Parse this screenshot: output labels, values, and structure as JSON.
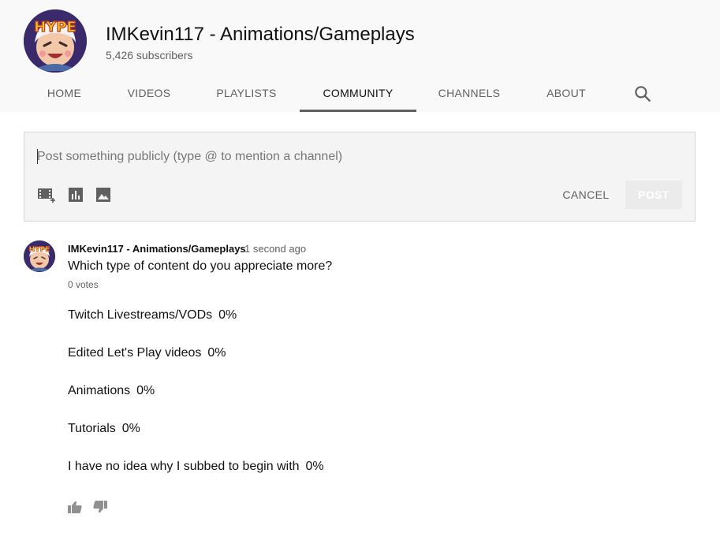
{
  "channel": {
    "title": "IMKevin117 - Animations/Gameplays",
    "subscribers": "5,426 subscribers",
    "avatar_text": "HYPE"
  },
  "tabs": [
    {
      "label": "HOME"
    },
    {
      "label": "VIDEOS"
    },
    {
      "label": "PLAYLISTS"
    },
    {
      "label": "COMMUNITY",
      "active": true
    },
    {
      "label": "CHANNELS"
    },
    {
      "label": "ABOUT"
    }
  ],
  "composer": {
    "placeholder": "Post something publicly (type @ to mention a channel)",
    "cancel_label": "CANCEL",
    "post_label": "POST",
    "tools": [
      "add-video-icon",
      "poll-icon",
      "image-icon"
    ]
  },
  "post": {
    "author": "IMKevin117 - Animations/Gameplays",
    "time": "1 second ago",
    "question": "Which type of content do you appreciate more?",
    "votes": "0 votes",
    "options": [
      {
        "label": "Twitch Livestreams/VODs",
        "percent": "0%"
      },
      {
        "label": "Edited Let's Play videos",
        "percent": "0%"
      },
      {
        "label": "Animations",
        "percent": "0%"
      },
      {
        "label": "Tutorials",
        "percent": "0%"
      },
      {
        "label": "I have no idea why I subbed to begin with",
        "percent": "0%"
      }
    ]
  },
  "colors": {
    "header_bg": "#f9f9f9",
    "tab_active_underline": "#606060",
    "secondary_text": "#606060",
    "avatar_yellow": "#f5c518",
    "avatar_red": "#c0392b"
  }
}
